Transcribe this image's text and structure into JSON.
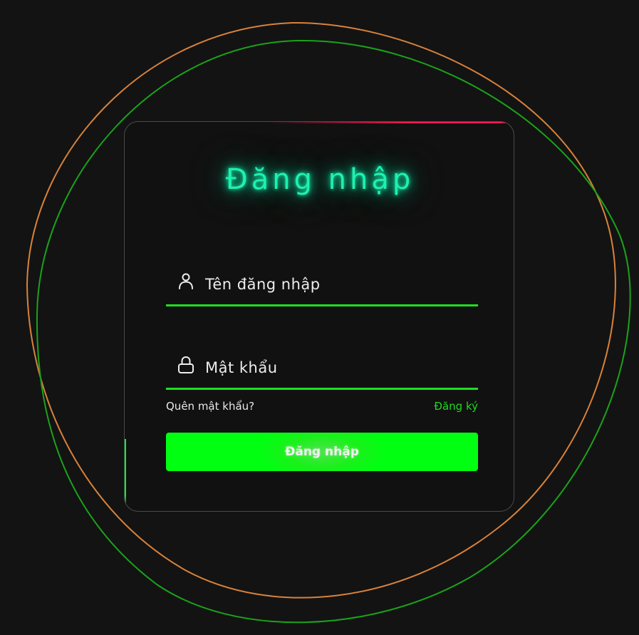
{
  "login": {
    "title": "Đăng nhập",
    "username_label": "Tên đăng nhập",
    "password_label": "Mật khẩu",
    "forgot_label": "Quên mật khẩu?",
    "register_label": "Đăng ký",
    "submit_label": "Đăng nhập"
  },
  "icons": {
    "username": "user-icon",
    "password": "lock-icon"
  },
  "colors": {
    "background": "#131313",
    "title_glow": "#1ff0b0",
    "accent_green": "#00ff11",
    "card_edge_red": "#ff1a55",
    "blob_orange": "#d9823a",
    "blob_green": "#1aa31a"
  }
}
